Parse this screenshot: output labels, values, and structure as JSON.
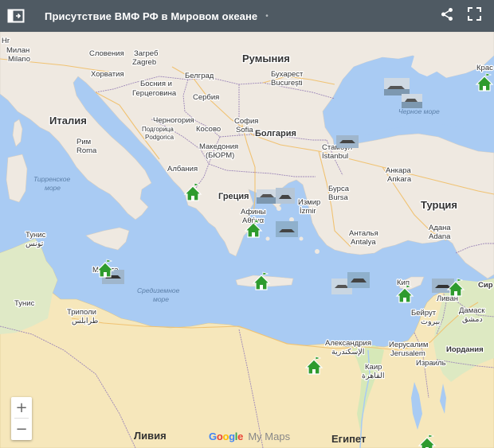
{
  "app": {
    "title": "Присутствие ВМФ РФ в Мировом океане",
    "title_dot": "•",
    "icons": [
      "sidebar-toggle-icon",
      "share-icon",
      "fullscreen-icon"
    ]
  },
  "colors": {
    "header": "#4f5a63",
    "sea": "#a9cbf3",
    "land": "#efe9e1",
    "desert": "#f6e7bb",
    "marker": "#2e9b2e",
    "border": "#9c86b8"
  },
  "map": {
    "labels": {
      "hr": "Hr",
      "milan": "Milano",
      "milan_ru": "Милан",
      "slovenia": "Словения",
      "zagreb": "Zagreb",
      "zagreb_ru": "Загреб",
      "croatia": "Хорватия",
      "bih1": "Босния и",
      "bih2": "Герцеговина",
      "belgrade": "Белград",
      "serbia": "Сербия",
      "romania": "Румыния",
      "bucharest": "Бухарест",
      "bucharesti": "București",
      "italy": "Италия",
      "rome": "Рим",
      "roma": "Roma",
      "tyrrh1": "Тирренское",
      "tyrrh2": "море",
      "podgorica": "Подгорица",
      "podgorica2": "Podgorica",
      "montenegro": "Черногория",
      "kosovo": "Косово",
      "sofia": "София",
      "sofia2": "Sofia",
      "bulgaria": "Болгария",
      "macedonia": "Македония",
      "macedonia2": "(БЮРМ)",
      "albania": "Албания",
      "greece": "Греция",
      "athens": "Афины",
      "athens2": "Αθήνα",
      "istanbul": "Стамбул",
      "istanbul2": "İstanbul",
      "bursa": "Бурса",
      "bursa2": "Bursa",
      "izmir": "Измир",
      "izmir2": "İzmir",
      "ankara": "Анкара",
      "ankara2": "Ankara",
      "turkey": "Турция",
      "antalya": "Анталья",
      "antalya2": "Antalya",
      "adana": "Адана",
      "adana2": "Adana",
      "blacksea": "Черное море",
      "kra": "Крас",
      "tunis_top": "Тунис",
      "tunis_ar": "تونس",
      "tunisia": "Тунис",
      "malta": "Мальта",
      "med1": "Средиземное",
      "med2": "море",
      "tripoli": "Триполи",
      "tripoli_ar": "طرابلس",
      "cyprus": "Кип",
      "syria": "Сир",
      "lebanon": "Ливан",
      "beirut": "Бейрут",
      "beirut_ar": "بيروت",
      "damascus": "Дамаск",
      "damascus_ar": "دمشق",
      "jordan": "Иордания",
      "jerusalem": "Иерусалим",
      "jerusalem2": "Jerusalem",
      "israel": "Израиль",
      "alexandria": "Александрия",
      "alexandria_ar": "الإسكندرية",
      "cairo": "Каир",
      "cairo_ar": "القاهرة",
      "libya": "Ливия",
      "egypt": "Египет"
    },
    "markers": 10,
    "ship_photos": 10
  },
  "branding": {
    "google": "Google",
    "mymaps": "My Maps"
  },
  "zoom": {
    "plus": "+",
    "minus": "−"
  }
}
